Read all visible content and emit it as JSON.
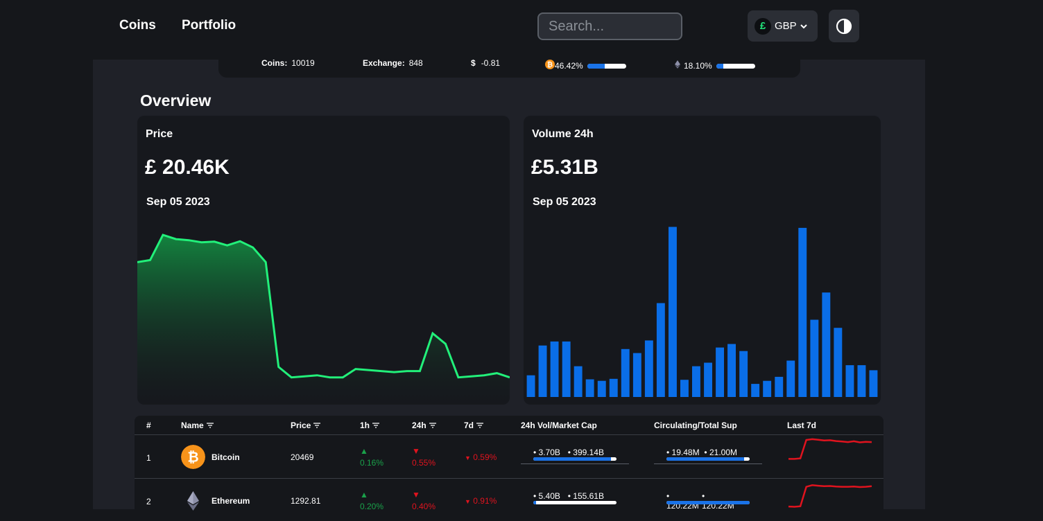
{
  "nav": {
    "coins": "Coins",
    "portfolio": "Portfolio"
  },
  "search": {
    "placeholder": "Search..."
  },
  "currency": {
    "symbol": "£",
    "code": "GBP"
  },
  "stats": {
    "coins_label": "Coins:",
    "coins_value": "10019",
    "exchange_label": "Exchange:",
    "exchange_value": "848",
    "change_symbol": "$",
    "change_value": "-0.81",
    "btc_dominance": "46.42%",
    "btc_dominance_fraction": 0.46,
    "eth_dominance": "18.10%",
    "eth_dominance_fraction": 0.18
  },
  "overview": {
    "title": "Overview"
  },
  "price_card": {
    "label": "Price",
    "value": "£ 20.46K",
    "date": "Sep 05 2023"
  },
  "volume_card": {
    "label": "Volume 24h",
    "value": "£5.31B",
    "date": "Sep 05 2023"
  },
  "colors": {
    "line": "#22f07a",
    "bar": "#0a6ee8",
    "up": "#1aa14a",
    "down": "#e0131e"
  },
  "chart_data": [
    {
      "type": "area",
      "values": [
        108,
        109,
        121,
        119,
        118.5,
        117.5,
        117.8,
        116,
        118,
        115,
        108,
        58,
        53,
        53.5,
        54,
        53,
        53,
        57,
        56.5,
        56,
        55.5,
        56,
        56,
        74,
        69,
        53,
        53.5,
        54,
        55,
        53
      ]
    },
    {
      "type": "bar",
      "values": [
        4.3,
        10.2,
        11,
        11,
        6.1,
        3.5,
        3.2,
        3.6,
        9.5,
        8.7,
        11.2,
        18.6,
        33.7,
        3.4,
        6.1,
        6.8,
        9.8,
        10.5,
        9.1,
        2.6,
        3.2,
        4,
        7.2,
        33.5,
        15.3,
        20.7,
        13.7,
        6.3,
        6.3,
        5.3
      ]
    }
  ],
  "table": {
    "headers": {
      "rank": "#",
      "name": "Name",
      "price": "Price",
      "h1": "1h",
      "h24": "24h",
      "d7": "7d",
      "vol": "24h Vol/Market Cap",
      "circ": "Circulating/Total Sup",
      "last7": "Last 7d"
    },
    "rows": [
      {
        "rank": "1",
        "name": "Bitcoin",
        "icon": "bitcoin-icon",
        "price": "20469",
        "h1": "0.16%",
        "h24": "0.55%",
        "d7": "0.59%",
        "vol_a": "3.70B",
        "vol_b": "399.14B",
        "vol_fraction": 0.93,
        "circ_a": "19.48M",
        "circ_b": "21.00M",
        "circ_fraction": 0.93,
        "spark": [
          0.2,
          0.2,
          0.22,
          0.92,
          0.95,
          0.93,
          0.9,
          0.91,
          0.88,
          0.86,
          0.84,
          0.87,
          0.83,
          0.85,
          0.84
        ]
      },
      {
        "rank": "2",
        "name": "Ethereum",
        "icon": "ethereum-icon",
        "price": "1292.81",
        "h1": "0.20%",
        "h24": "0.40%",
        "d7": "0.91%",
        "vol_a": "5.40B",
        "vol_b": "155.61B",
        "vol_fraction": 0.03,
        "circ_a": "120.22M",
        "circ_b": "120.22M",
        "circ_fraction": 1.0,
        "spark": [
          0.05,
          0.04,
          0.06,
          0.8,
          0.86,
          0.84,
          0.82,
          0.83,
          0.81,
          0.8,
          0.8,
          0.81,
          0.79,
          0.8,
          0.82
        ]
      }
    ]
  }
}
